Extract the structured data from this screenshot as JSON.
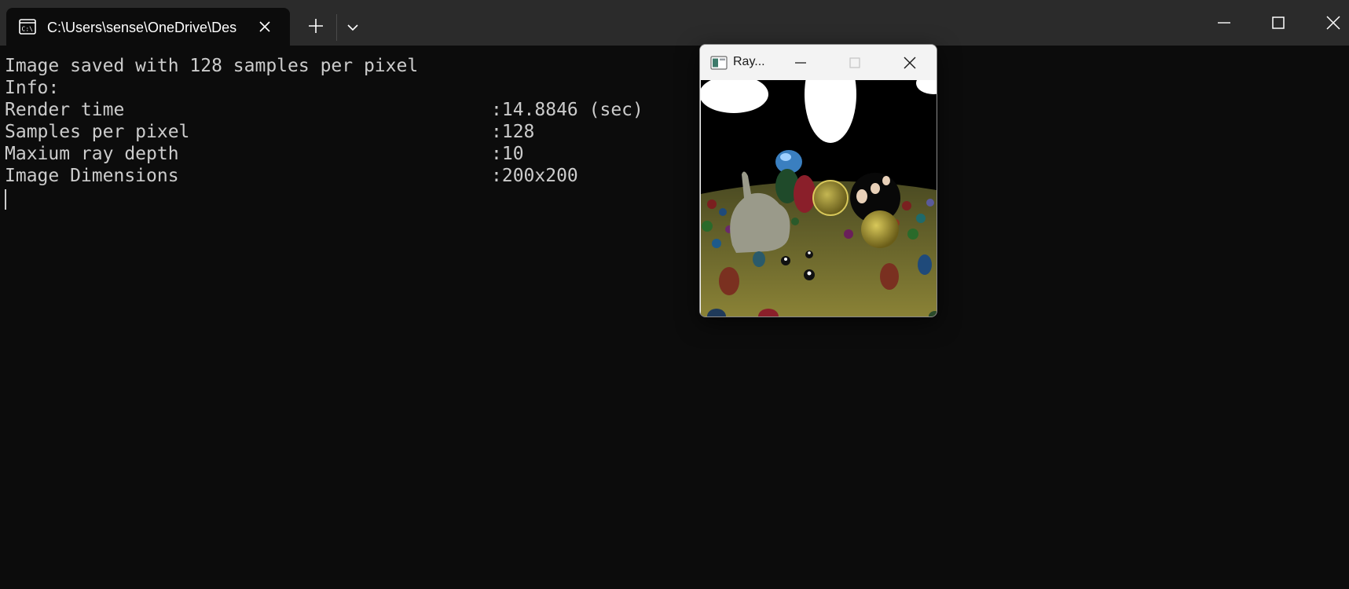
{
  "terminal_tab": {
    "title": "C:\\Users\\sense\\OneDrive\\Des"
  },
  "output": {
    "line1": "Image saved with 128 samples per pixel",
    "line2": "Info:",
    "rows": [
      {
        "label": "Render time",
        "value": ":14.8846 (sec)"
      },
      {
        "label": "Samples per pixel",
        "value": ":128"
      },
      {
        "label": "Maxium ray depth",
        "value": ":10"
      },
      {
        "label": "Image Dimensions",
        "value": ":200x200"
      }
    ]
  },
  "render_window": {
    "title": "Ray..."
  },
  "icons": {
    "tab": "cmd-prompt-icon",
    "tab_close": "close-icon",
    "new_tab": "plus-icon",
    "dropdown": "chevron-down-icon",
    "minimize": "minimize-icon",
    "maximize": "maximize-icon",
    "close": "close-icon"
  },
  "colors": {
    "terminal_bg": "#0c0c0c",
    "titlebar_bg": "#2b2b2b",
    "text": "#cccccc",
    "render_window_chrome": "#f3f3f3"
  }
}
